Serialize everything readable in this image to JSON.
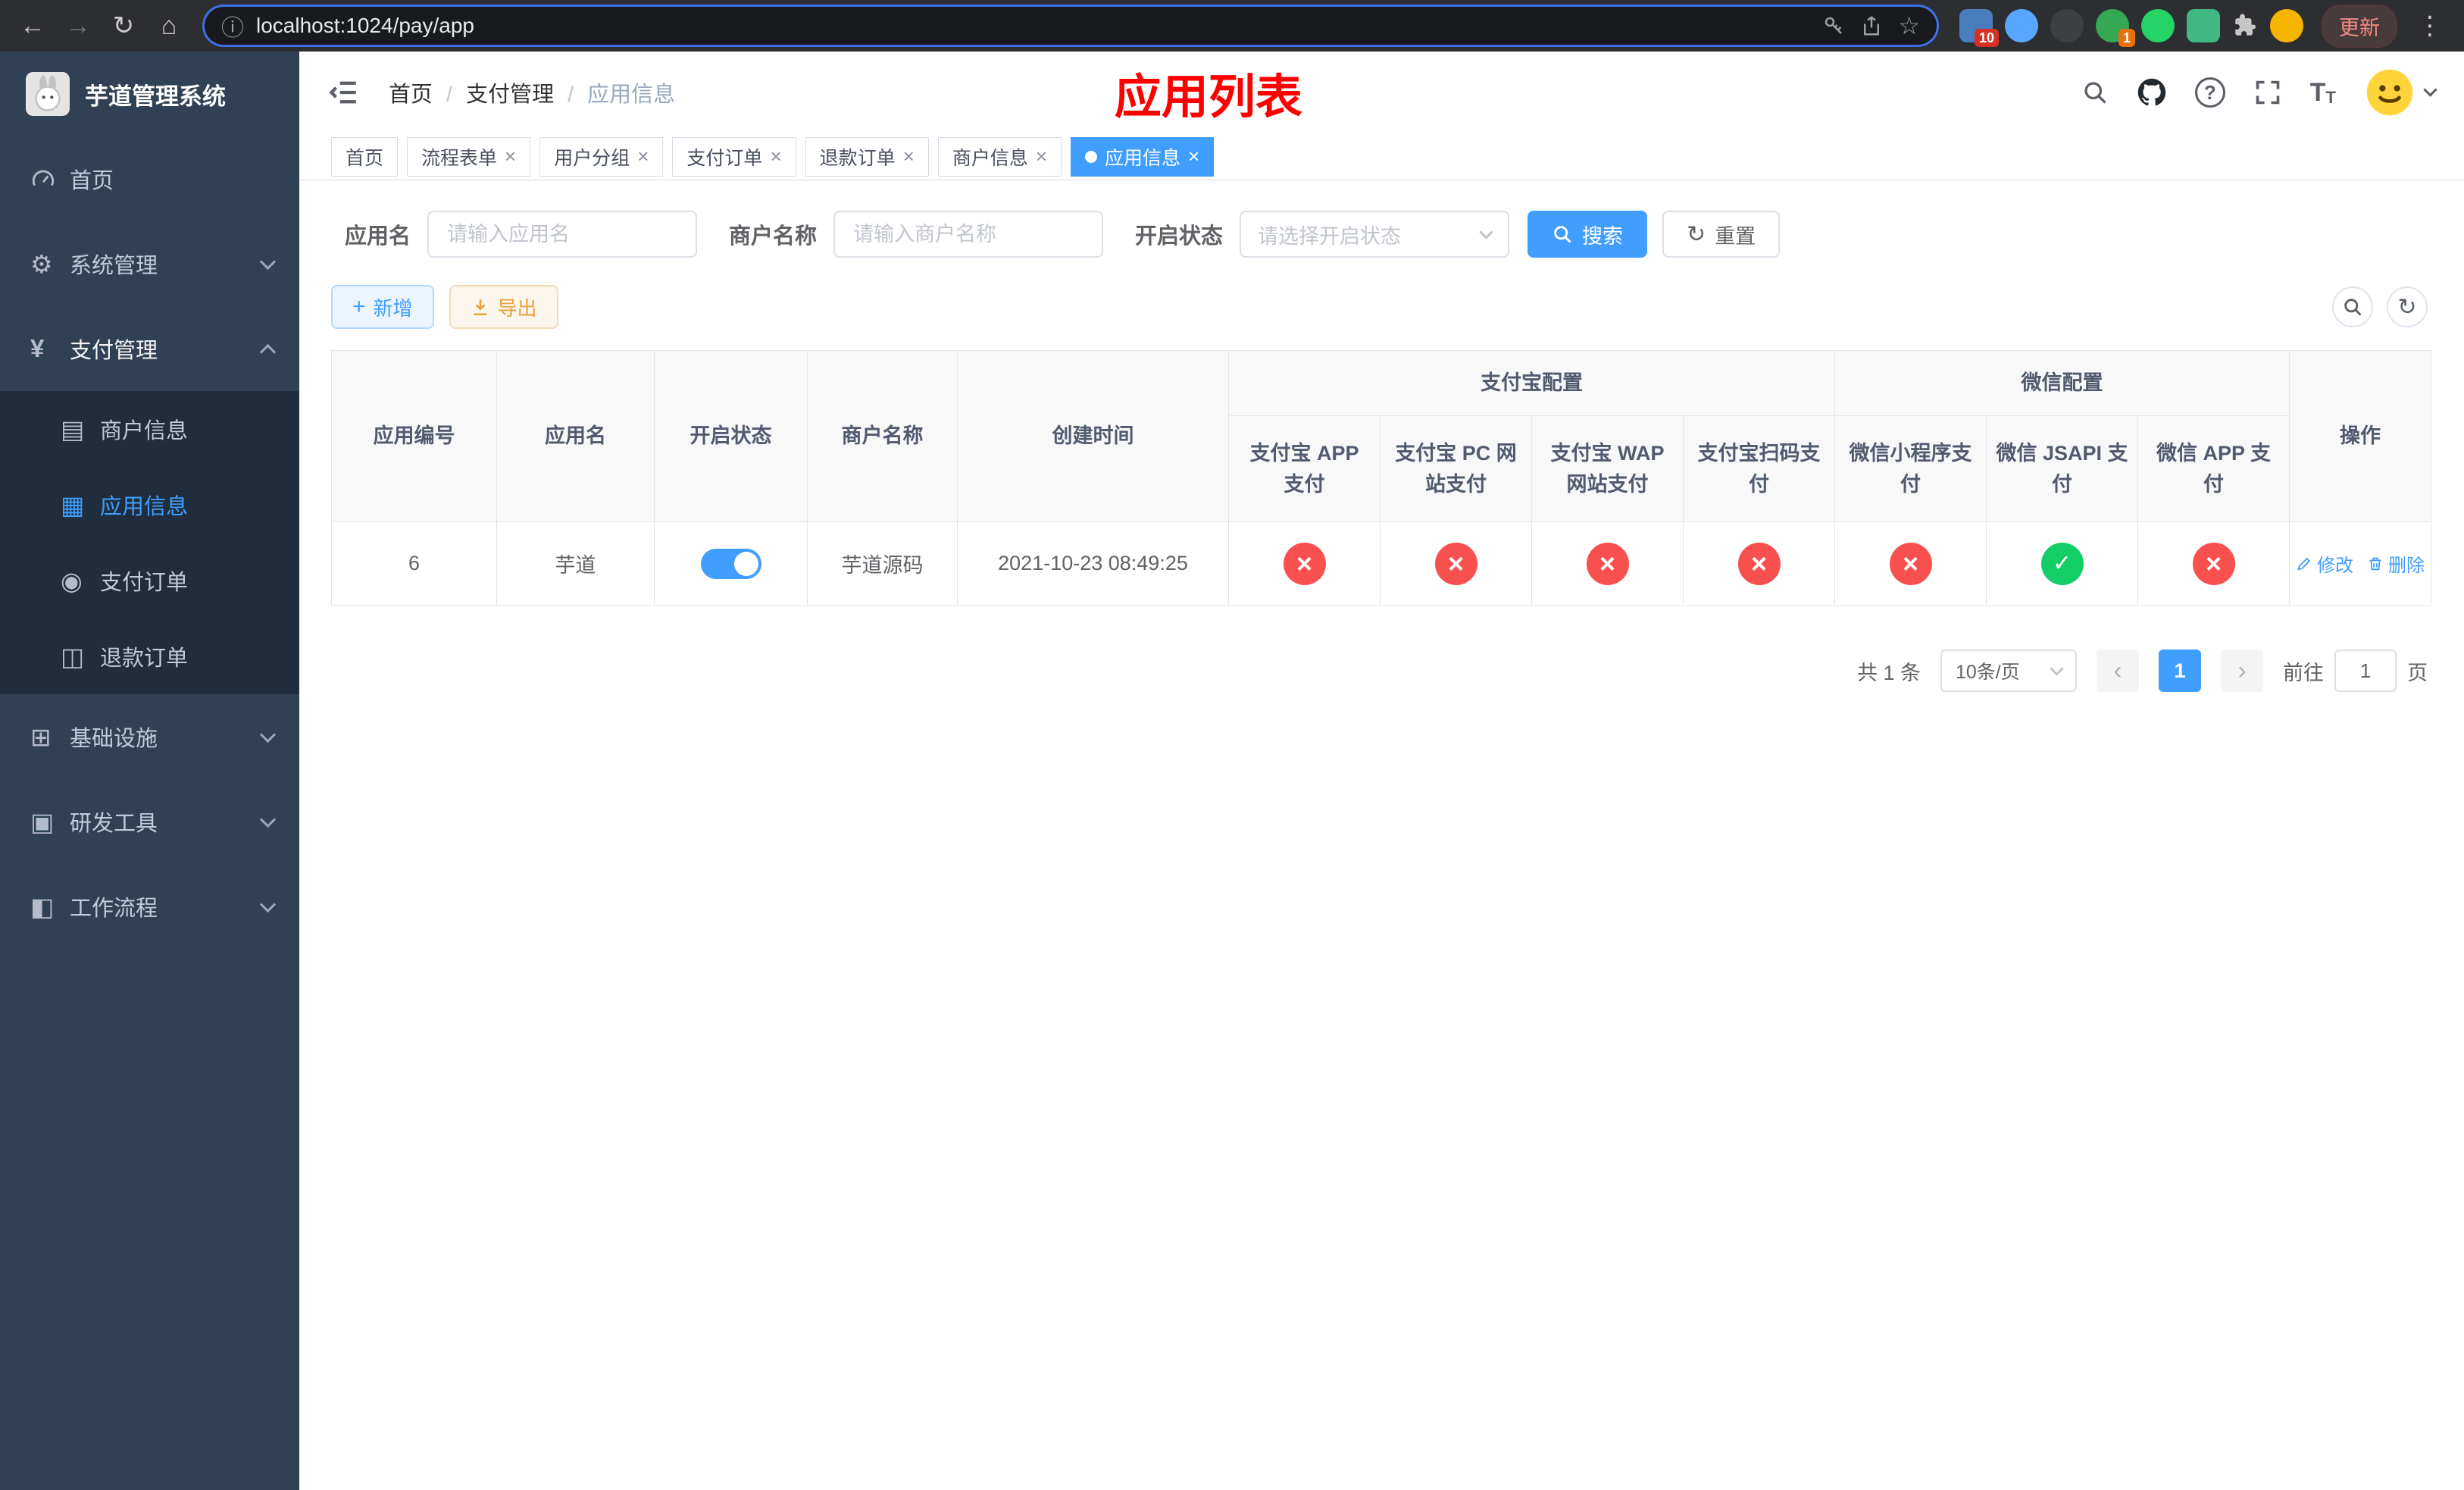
{
  "browser": {
    "url": "localhost:1024/pay/app",
    "update_label": "更新",
    "extension_badges": [
      "10",
      "1"
    ]
  },
  "sidebar": {
    "app_title": "芋道管理系统",
    "items": [
      {
        "label": "首页"
      },
      {
        "label": "系统管理"
      },
      {
        "label": "支付管理"
      },
      {
        "label": "基础设施"
      },
      {
        "label": "研发工具"
      },
      {
        "label": "工作流程"
      }
    ],
    "payment_children": [
      {
        "label": "商户信息"
      },
      {
        "label": "应用信息"
      },
      {
        "label": "支付订单"
      },
      {
        "label": "退款订单"
      }
    ]
  },
  "header": {
    "breadcrumb": [
      "首页",
      "支付管理",
      "应用信息"
    ],
    "page_title": "应用列表"
  },
  "tabs": [
    {
      "label": "首页",
      "closable": false,
      "active": false
    },
    {
      "label": "流程表单",
      "closable": true,
      "active": false
    },
    {
      "label": "用户分组",
      "closable": true,
      "active": false
    },
    {
      "label": "支付订单",
      "closable": true,
      "active": false
    },
    {
      "label": "退款订单",
      "closable": true,
      "active": false
    },
    {
      "label": "商户信息",
      "closable": true,
      "active": false
    },
    {
      "label": "应用信息",
      "closable": true,
      "active": true
    }
  ],
  "filters": {
    "app_name": {
      "label": "应用名",
      "placeholder": "请输入应用名",
      "value": ""
    },
    "merchant_name": {
      "label": "商户名称",
      "placeholder": "请输入商户名称",
      "value": ""
    },
    "status": {
      "label": "开启状态",
      "placeholder": "请选择开启状态"
    },
    "search_button": "搜索",
    "reset_button": "重置"
  },
  "toolbar": {
    "add_button": "新增",
    "export_button": "导出"
  },
  "table": {
    "headers": {
      "app_id": "应用编号",
      "app_name": "应用名",
      "status": "开启状态",
      "merchant_name": "商户名称",
      "create_time": "创建时间",
      "alipay_group": "支付宝配置",
      "wechat_group": "微信配置",
      "alipay_app": "支付宝 APP 支付",
      "alipay_pc": "支付宝 PC 网站支付",
      "alipay_wap": "支付宝 WAP 网站支付",
      "alipay_qr": "支付宝扫码支付",
      "wechat_mini": "微信小程序支付",
      "wechat_jsapi": "微信 JSAPI 支付",
      "wechat_app": "微信 APP 支付",
      "actions": "操作"
    },
    "rows": [
      {
        "app_id": "6",
        "app_name": "芋道",
        "status_enabled": true,
        "merchant_name": "芋道源码",
        "create_time": "2021-10-23 08:49:25",
        "alipay_app": false,
        "alipay_pc": false,
        "alipay_wap": false,
        "alipay_qr": false,
        "wechat_mini": false,
        "wechat_jsapi": true,
        "wechat_app": false,
        "edit_label": "修改",
        "delete_label": "删除"
      }
    ]
  },
  "pagination": {
    "total_text": "共 1 条",
    "page_size_text": "10条/页",
    "current_page": "1",
    "goto_prefix": "前往",
    "goto_value": "1",
    "goto_suffix": "页"
  },
  "colors": {
    "accent_blue": "#409eff",
    "success_green": "#13ce66",
    "danger_red": "#f8504f",
    "warning_orange": "#e6a23c",
    "title_red": "#ff0000",
    "sidebar_bg": "#304156",
    "submenu_bg": "#1f2d3d"
  }
}
